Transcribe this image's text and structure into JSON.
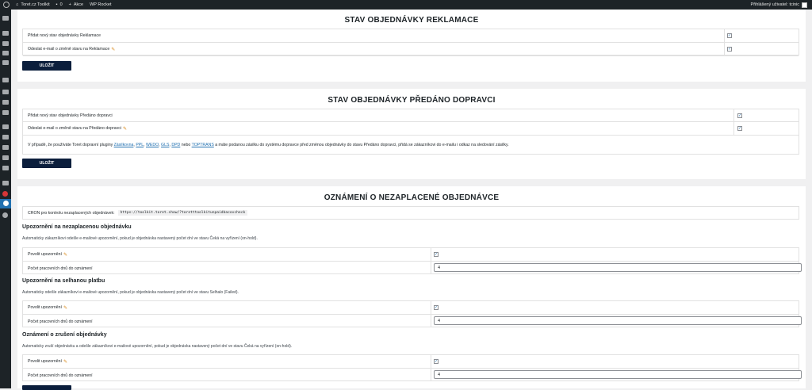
{
  "adminbar": {
    "site_name": "Toret.cz Toolkit",
    "comments_count": "0",
    "new_label": "Akce",
    "wp_rocket": "WP Rocket",
    "user_label": "Přihlášený uživatel: tcinic"
  },
  "section1": {
    "title": "STAV OBJEDNÁVKY REKLAMACE",
    "rows": [
      {
        "label": "Přidat nový stav objednávky Reklamace",
        "checked": true
      },
      {
        "label": "Odeslat e-mail o změně stavu na Reklamace",
        "checked": true
      }
    ],
    "save_label": "ULOŽIT"
  },
  "section2": {
    "title": "STAV OBJEDNÁVKY PŘEDÁNO DOPRAVCI",
    "rows": [
      {
        "label": "Přidat nový stav objednávky Předáno dopravci",
        "checked": true
      },
      {
        "label": "Odeslat e-mail o změně stavu na Předáno dopravci",
        "checked": true
      }
    ],
    "info_prefix": "V případě, že používáte Toret dopravní pluginy ",
    "link_zasilkovna": "Zásilkovna",
    "sep1": ", ",
    "link_ppl": "PPL",
    "link_wedo": "WEDO",
    "link_gls": "GLS",
    "link_dpd": "DPD",
    "info_nebo": " nebo ",
    "link_toptrans": "TOPTRANS",
    "info_suffix": " a máte podanou zásilku do systému dopravce před změnou objednávky do stavu Předáno dopravci, přidá se zákazníkovi do e-mailu i odkaz na sledování zásilky.",
    "save_label": "ULOŽIT"
  },
  "section3": {
    "title": "OZNÁMENÍ O NEZAPLACENÉ OBJEDNÁVCE",
    "cron_label": "CRON pro kontrolu nezaplacených objednávek:",
    "cron_url": "https://toolkit.toret.show/?toretttoolkitunpaidbacovcheck",
    "groups": [
      {
        "title": "Upozornění na nezaplacenou objednávku",
        "description": "Automaticky zákazníkovi odešle e-mailové upozornění, pokud je objednávka nastavený počet dní ve stavu Čeká na vyřízení (on-hold).",
        "enable_label": "Povolit upozornění",
        "days_label": "Počet pracovních dnů do oznámení",
        "days_value": "4"
      },
      {
        "title": "Upozornění na selhanou platbu",
        "description": "Automaticky odešle zákazníkovi e-mailové upozornění, pokud je objednávka nastavený počet dní ve stavu Selhalo (Failed).",
        "enable_label": "Povolit upozornění",
        "days_label": "Počet pracovních dnů do oznámení",
        "days_value": "4"
      },
      {
        "title": "Oznámení o zrušení objednávky",
        "description": "Automaticky zruší objednávku a odešle zákazníkovi e-mailové upozornění, pokud je objednávka nastavený počet dní ve stavu Čeká na vyřízení (on-hold).",
        "enable_label": "Povolit upozornění",
        "days_label": "Počet pracovních dnů do oznámení",
        "days_value": "4"
      }
    ]
  }
}
